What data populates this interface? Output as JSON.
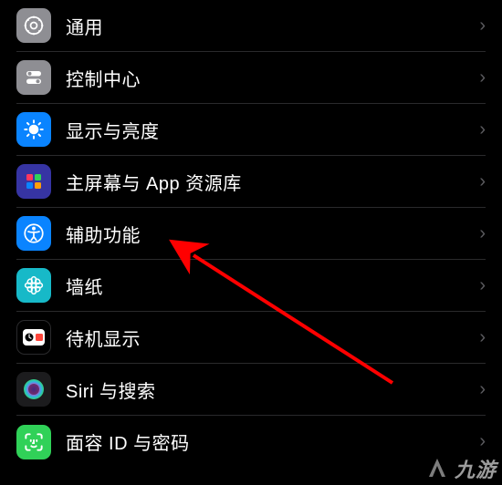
{
  "settings": {
    "items": [
      {
        "id": "general",
        "label": "通用",
        "icon": "gear-icon",
        "bg": "#8e8e93"
      },
      {
        "id": "control-center",
        "label": "控制中心",
        "icon": "switches-icon",
        "bg": "#8e8e93"
      },
      {
        "id": "display",
        "label": "显示与亮度",
        "icon": "sun-icon",
        "bg": "#0a84ff"
      },
      {
        "id": "home-screen",
        "label": "主屏幕与 App 资源库",
        "icon": "grid-icon",
        "bg": "#3634a3"
      },
      {
        "id": "accessibility",
        "label": "辅助功能",
        "icon": "accessibility-icon",
        "bg": "#0a84ff"
      },
      {
        "id": "wallpaper",
        "label": "墙纸",
        "icon": "flower-icon",
        "bg": "#17b9c8"
      },
      {
        "id": "standby",
        "label": "待机显示",
        "icon": "standby-icon",
        "bg": "#000000"
      },
      {
        "id": "siri",
        "label": "Siri 与搜索",
        "icon": "siri-icon",
        "bg": "#1c1c1e"
      },
      {
        "id": "faceid",
        "label": "面容 ID 与密码",
        "icon": "faceid-icon",
        "bg": "#30d158"
      }
    ]
  },
  "watermark": {
    "text": "九游"
  },
  "annotation": {
    "arrow_color": "#ff0000"
  }
}
